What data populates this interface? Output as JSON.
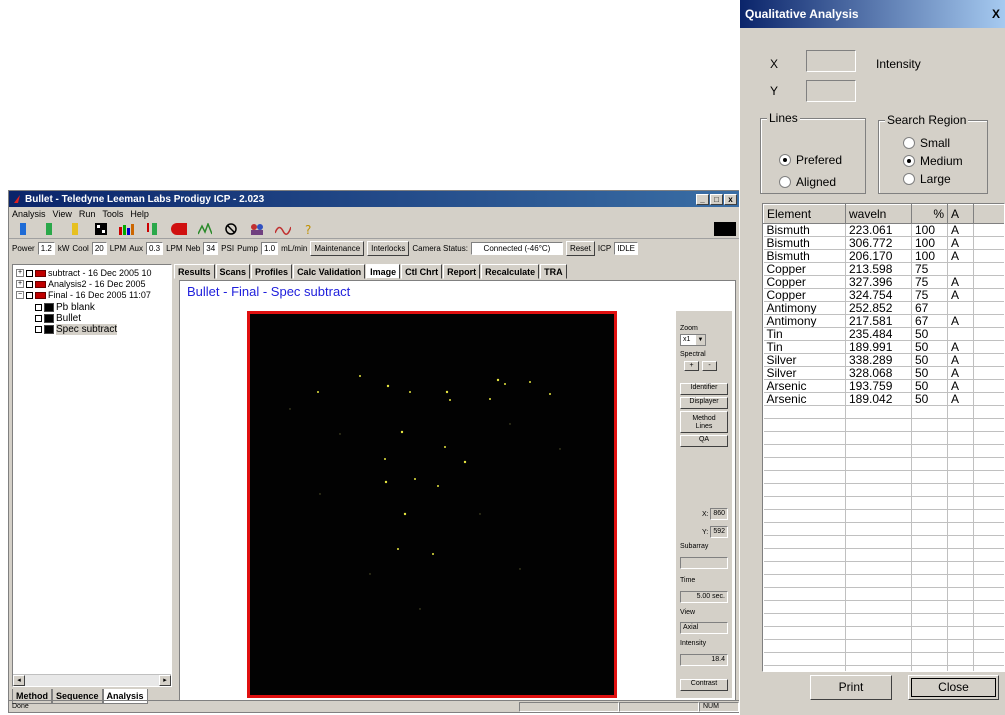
{
  "main": {
    "title": "Bullet - Teledyne Leeman Labs Prodigy ICP - 2.023",
    "menu": [
      "Analysis",
      "View",
      "Run",
      "Tools",
      "Help"
    ],
    "status": {
      "power_label": "Power",
      "power_value": "1.2",
      "power_unit": "kW",
      "cool_label": "Cool",
      "cool_value": "20",
      "cool_unit": "LPM",
      "aux_label": "Aux",
      "aux_value": "0.3",
      "aux_unit": "LPM",
      "neb_label": "Neb",
      "neb_value": "34",
      "neb_unit": "PSI",
      "pump_label": "Pump",
      "pump_value": "1.0",
      "pump_unit": "mL/min",
      "maintenance": "Maintenance",
      "interlocks": "Interlocks",
      "camera_label": "Camera Status:",
      "camera_value": "Connected (-46°C)",
      "reset": "Reset",
      "icp_label": "ICP",
      "icp_value": "IDLE"
    },
    "tree": {
      "n1": "subtract - 16 Dec 2005 10",
      "n2": "Analysis2 - 16 Dec 2005",
      "n3": "Final - 16 Dec 2005 11:07",
      "c1": "Pb blank",
      "c2": "Bullet",
      "c3": "Spec subtract"
    },
    "bottom_tabs": [
      "Method",
      "Sequence",
      "Analysis"
    ],
    "tabs": [
      "Results",
      "Scans",
      "Profiles",
      "Calc Validation",
      "Image",
      "Ctl Chrt",
      "Report",
      "Recalculate",
      "TRA"
    ],
    "content_title": "Bullet - Final - Spec subtract",
    "side": {
      "zoom_label": "Zoom",
      "zoom_value": "x1",
      "spectral_label": "Spectral",
      "plus": "+",
      "minus": "-",
      "identifier": "Identifier",
      "displayer": "Displayer",
      "method_lines": "Method Lines",
      "qa": "QA",
      "x_label": "X:",
      "x_value": "860",
      "y_label": "Y:",
      "y_value": "592",
      "subarray_label": "Subarray",
      "subarray_value": "",
      "time_label": "Time",
      "time_value": "5.00 sec.",
      "view_label": "View",
      "view_value": "Axial",
      "intensity_label": "Intensity",
      "intensity_value": "18.4",
      "contrast": "Contrast"
    },
    "statusbar": {
      "left": "Done",
      "num": "NUM"
    }
  },
  "qa": {
    "title": "Qualitative Analysis",
    "close_x": "X",
    "x_label": "X",
    "y_label": "Y",
    "intensity_label": "Intensity",
    "lines_label": "Lines",
    "preferred": "Prefered",
    "aligned": "Aligned",
    "region_label": "Search Region",
    "small": "Small",
    "medium": "Medium",
    "large": "Large",
    "columns": [
      "Element",
      "waveln",
      "%",
      "A"
    ],
    "rows": [
      [
        "Bismuth",
        "223.061",
        "100",
        "A"
      ],
      [
        "Bismuth",
        "306.772",
        "100",
        "A"
      ],
      [
        "Bismuth",
        "206.170",
        "100",
        "A"
      ],
      [
        "Copper",
        "213.598",
        "75",
        ""
      ],
      [
        "Copper",
        "327.396",
        "75",
        "A"
      ],
      [
        "Copper",
        "324.754",
        "75",
        "A"
      ],
      [
        "Antimony",
        "252.852",
        "67",
        ""
      ],
      [
        "Antimony",
        "217.581",
        "67",
        "A"
      ],
      [
        "Tin",
        "235.484",
        "50",
        ""
      ],
      [
        "Tin",
        "189.991",
        "50",
        "A"
      ],
      [
        "Silver",
        "338.289",
        "50",
        "A"
      ],
      [
        "Silver",
        "328.068",
        "50",
        "A"
      ],
      [
        "Arsenic",
        "193.759",
        "50",
        "A"
      ],
      [
        "Arsenic",
        "189.042",
        "50",
        "A"
      ]
    ],
    "print": "Print",
    "close": "Close"
  },
  "colors": {
    "title_blue": "#0a246a",
    "content_title": "#1e1edc",
    "frame_red": "#e01010",
    "dot": "#e6e640"
  }
}
